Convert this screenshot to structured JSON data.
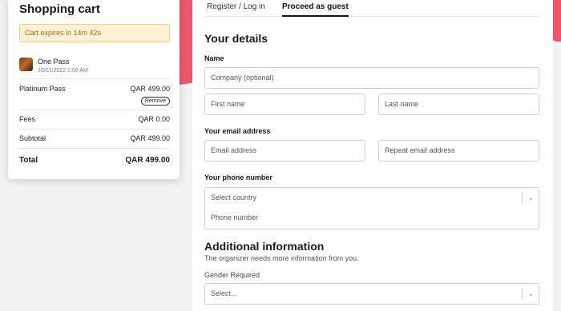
{
  "cart": {
    "title": "Shopping cart",
    "expiry": "Cart expires in 14m 42s",
    "item": {
      "name": "One Pass",
      "date": "10/01/2022 1:00 AM"
    },
    "line_item": {
      "label": "Platinum Pass",
      "price": "QAR 499.00",
      "remove_label": "Remove"
    },
    "fees": {
      "label": "Fees",
      "value": "QAR 0.00"
    },
    "subtotal": {
      "label": "Subtotal",
      "value": "QAR 499.00"
    },
    "total": {
      "label": "Total",
      "value": "QAR 499.00"
    }
  },
  "tabs": [
    {
      "label": "Register / Log in",
      "active": false
    },
    {
      "label": "Proceed as guest",
      "active": true
    }
  ],
  "form": {
    "details_heading": "Your details",
    "name_label": "Name",
    "company_placeholder": "Company (optional)",
    "first_name_placeholder": "First name",
    "last_name_placeholder": "Last name",
    "email_label": "Your email address",
    "email_placeholder": "Email address",
    "repeat_email_placeholder": "Repeat email address",
    "phone_label": "Your phone number",
    "country_placeholder": "Select country",
    "phone_placeholder": "Phone number",
    "additional_heading": "Additional information",
    "additional_help": "The organizer needs more information from you.",
    "gender_label": "Gender Required",
    "gender_placeholder": "Select..."
  },
  "colors": {
    "accent": "#f0566a",
    "warning_bg": "#fdf3d4",
    "warning_text": "#9a6c08"
  }
}
